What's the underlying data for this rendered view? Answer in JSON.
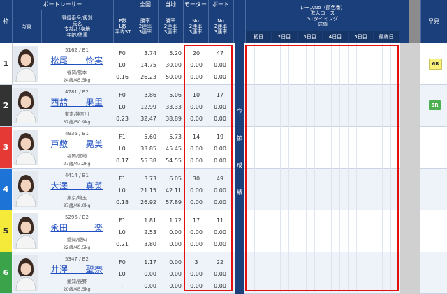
{
  "header": {
    "waku": "枠",
    "boat_racer": "ボートレーサー",
    "photo": "写真",
    "info_label": "登録番号/級別\n氏名\n支部/出身地\n年齢/体重",
    "flst_label": "F数\nL数\n平均ST",
    "zenkoku": "全国",
    "tochi": "当地",
    "motor": "モーター",
    "boat": "ボート",
    "rate_label": "勝率\n2連率\n3連率",
    "no_label": "No\n2連率\n3連率",
    "race_no_label": "レースNo（節色番）\n進入コース\nSTタイミング\n成績",
    "hayami": "早見",
    "days": [
      "初日",
      "2日目",
      "3日目",
      "4日目",
      "5日目",
      "最終日"
    ]
  },
  "konsetsu_label": [
    "今",
    "節",
    "成",
    "績"
  ],
  "racers": [
    {
      "waku": "1",
      "reg": "5162 / B1",
      "name": "松尾　　怜実",
      "branch": "福岡/熊本",
      "age": "24歳/45.5kg",
      "f": "F0",
      "l": "L0",
      "st": "0.16",
      "z": [
        "3.74",
        "14.75",
        "26.23"
      ],
      "t": [
        "5.20",
        "30.00",
        "50.00"
      ],
      "m": [
        "20",
        "0.00",
        "0.00"
      ],
      "b": [
        "47",
        "0.00",
        "0.00"
      ],
      "hayami": "6R"
    },
    {
      "waku": "2",
      "reg": "4781 / B2",
      "name": "西舘　　果里",
      "branch": "東京/神奈川",
      "age": "37歳/50.9kg",
      "f": "F0",
      "l": "L0",
      "st": "0.23",
      "z": [
        "3.86",
        "12.99",
        "32.47"
      ],
      "t": [
        "5.06",
        "33.33",
        "38.89"
      ],
      "m": [
        "10",
        "0.00",
        "0.00"
      ],
      "b": [
        "17",
        "0.00",
        "0.00"
      ],
      "hayami": "5R"
    },
    {
      "waku": "3",
      "reg": "4936 / B1",
      "name": "戸敷　　晃美",
      "branch": "福岡/宮崎",
      "age": "27歳/47.2kg",
      "f": "F1",
      "l": "L0",
      "st": "0.17",
      "z": [
        "5.60",
        "33.85",
        "55.38"
      ],
      "t": [
        "5.73",
        "45.45",
        "54.55"
      ],
      "m": [
        "14",
        "0.00",
        "0.00"
      ],
      "b": [
        "19",
        "0.00",
        "0.00"
      ],
      "hayami": ""
    },
    {
      "waku": "4",
      "reg": "4414 / B1",
      "name": "大澤　　真菜",
      "branch": "東京/埼玉",
      "age": "37歳/46.0kg",
      "f": "F1",
      "l": "L0",
      "st": "0.18",
      "z": [
        "3.73",
        "21.15",
        "26.92"
      ],
      "t": [
        "6.05",
        "42.11",
        "57.89"
      ],
      "m": [
        "30",
        "0.00",
        "0.00"
      ],
      "b": [
        "49",
        "0.00",
        "0.00"
      ],
      "hayami": ""
    },
    {
      "waku": "5",
      "reg": "5296 / B2",
      "name": "永田　　　楽",
      "branch": "愛知/愛知",
      "age": "22歳/45.5kg",
      "f": "F1",
      "l": "L0",
      "st": "0.21",
      "z": [
        "1.81",
        "2.53",
        "3.80"
      ],
      "t": [
        "1.72",
        "0.00",
        "0.00"
      ],
      "m": [
        "17",
        "0.00",
        "0.00"
      ],
      "b": [
        "11",
        "0.00",
        "0.00"
      ],
      "hayami": ""
    },
    {
      "waku": "6",
      "reg": "5347 / B2",
      "name": "井澤　　聖奈",
      "branch": "愛知/長野",
      "age": "20歳/45.5kg",
      "f": "F0",
      "l": "L0",
      "st": "-",
      "z": [
        "1.17",
        "0.00",
        "0.00"
      ],
      "t": [
        "0.00",
        "0.00",
        "0.00"
      ],
      "m": [
        "3",
        "0.00",
        "0.00"
      ],
      "b": [
        "22",
        "0.00",
        "0.00"
      ],
      "hayami": ""
    }
  ],
  "colors": {
    "header_bg": "#1a3f7a",
    "waku": [
      "#ffffff",
      "#333333",
      "#e53935",
      "#1e73d6",
      "#f5e93a",
      "#3ba34a"
    ],
    "waku_text": [
      "#333333",
      "#ffffff",
      "#ffffff",
      "#ffffff",
      "#333333",
      "#ffffff"
    ],
    "highlight_box": "#e31010",
    "hayami_badge_yellow": "#f7f07a",
    "hayami_badge_green": "#4caf50"
  }
}
